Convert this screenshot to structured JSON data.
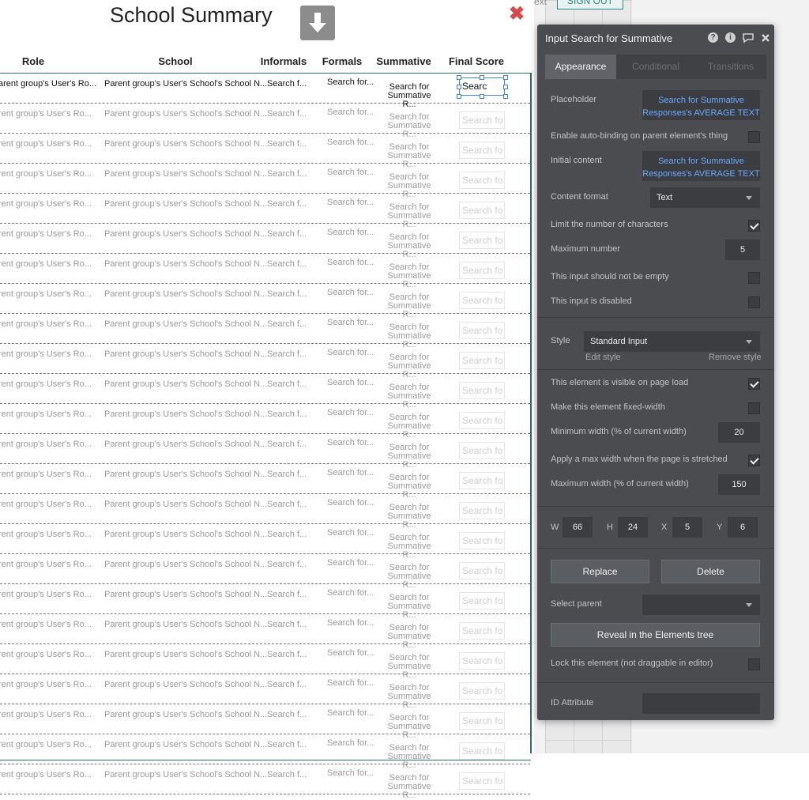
{
  "topbar": {
    "text_fragment": "ext",
    "signout": "SIGN OUT"
  },
  "page": {
    "title": "School Summary",
    "close_glyph": "✖",
    "columns": {
      "role": "Role",
      "school": "School",
      "informals": "Informals",
      "formals": "Formals",
      "summative": "Summative",
      "final": "Final Score"
    }
  },
  "first_row": {
    "role": "arent group's User's Ro...",
    "school": "Parent group's User's School's School N...",
    "informals": "Search f...",
    "formals": "Search for...",
    "summative_line1": "Search for",
    "summative_line2": "Summative R...",
    "final": "Searc"
  },
  "row": {
    "role": "rent group's User's Ro...",
    "school": "Parent group's User's School's School N...",
    "informals": "Search f...",
    "formals": "Search for...",
    "summative_line1": "Search for",
    "summative_line2": "Summative R...",
    "final": "Search fo"
  },
  "icons": {
    "download": "download-arrow-icon",
    "close": "close-icon",
    "help": "help-icon",
    "info": "info-icon",
    "comment": "comment-icon",
    "panel_close": "panel-close-icon"
  },
  "inspector": {
    "title": "Input Search for Summative",
    "tabs": [
      "Appearance",
      "Conditional",
      "Transitions"
    ],
    "placeholder": {
      "label": "Placeholder",
      "line1": "Search for Summative",
      "line2": "Responses's AVERAGE TEXT"
    },
    "auto_binding": {
      "label": "Enable auto-binding on parent element's thing",
      "checked": false
    },
    "initial_content": {
      "label": "Initial content",
      "line1": "Search for Summative",
      "line2": "Responses's AVERAGE TEXT"
    },
    "content_format": {
      "label": "Content format",
      "value": "Text"
    },
    "limit_chars": {
      "label": "Limit the number of characters",
      "checked": true
    },
    "max_number": {
      "label": "Maximum number",
      "value": "5"
    },
    "not_empty": {
      "label": "This input should not be empty",
      "checked": false
    },
    "disabled": {
      "label": "This input is disabled",
      "checked": false
    },
    "style": {
      "label": "Style",
      "value": "Standard Input",
      "edit": "Edit style",
      "remove": "Remove style"
    },
    "visible_on_load": {
      "label": "This element is visible on page load",
      "checked": true
    },
    "fixed_width": {
      "label": "Make this element fixed-width",
      "checked": false
    },
    "min_width": {
      "label": "Minimum width (% of current width)",
      "value": "20"
    },
    "max_width_apply": {
      "label": "Apply a max width when the page is stretched",
      "checked": true
    },
    "max_width": {
      "label": "Maximum width (% of current width)",
      "value": "150"
    },
    "dims": {
      "w_label": "W",
      "w": "66",
      "h_label": "H",
      "h": "24",
      "x_label": "X",
      "x": "5",
      "y_label": "Y",
      "y": "6"
    },
    "replace": "Replace",
    "delete": "Delete",
    "select_parent": {
      "label": "Select parent",
      "value": ""
    },
    "reveal": "Reveal in the Elements tree",
    "lock": {
      "label": "Lock this element (not draggable in editor)",
      "checked": false
    },
    "id_attribute": {
      "label": "ID Attribute",
      "value": ""
    }
  },
  "colors": {
    "accent_teal": "#2d6e73",
    "panel_bg": "#4a4c4f",
    "link_blue": "#6aa8ff",
    "close_red": "#d84a4a",
    "selection_blue": "#3e86d1"
  }
}
